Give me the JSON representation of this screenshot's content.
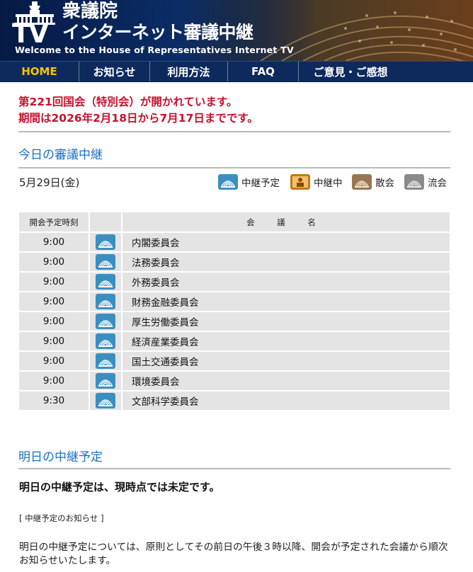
{
  "header": {
    "logo_tv": "TV",
    "site_name": "衆議院",
    "site_subtitle": "インターネット審議中継",
    "welcome": "Welcome to the House of Representatives Internet TV"
  },
  "nav": {
    "items": [
      {
        "label": "HOME"
      },
      {
        "label": "お知らせ"
      },
      {
        "label": "利用方法"
      },
      {
        "label": "FAQ"
      },
      {
        "label": "ご意見・ご感想"
      }
    ],
    "active_color": "#f5c400",
    "background": "#0e2a5c"
  },
  "notice": {
    "line1": "第221回国会（特別会）が開かれています。",
    "line2": "期間は2026年2月18日から7月17日までです。",
    "color": "#c8102e"
  },
  "today": {
    "heading": "今日の審議中継",
    "date": "5月29日(金)",
    "legend": [
      {
        "icon": "scheduled-broadcast-icon",
        "label": "中継予定"
      },
      {
        "icon": "live-broadcast-icon",
        "label": "中継中"
      },
      {
        "icon": "adjourned-icon",
        "label": "散会"
      },
      {
        "icon": "cancelled-icon",
        "label": "流会"
      }
    ],
    "table": {
      "headers": {
        "time": "開会予定時刻",
        "name": "会 議 名"
      },
      "rows": [
        {
          "time": "9:00",
          "name": "内閣委員会",
          "status": "scheduled-broadcast-icon"
        },
        {
          "time": "9:00",
          "name": "法務委員会",
          "status": "scheduled-broadcast-icon"
        },
        {
          "time": "9:00",
          "name": "外務委員会",
          "status": "scheduled-broadcast-icon"
        },
        {
          "time": "9:00",
          "name": "財務金融委員会",
          "status": "scheduled-broadcast-icon"
        },
        {
          "time": "9:00",
          "name": "厚生労働委員会",
          "status": "scheduled-broadcast-icon"
        },
        {
          "time": "9:00",
          "name": "経済産業委員会",
          "status": "scheduled-broadcast-icon"
        },
        {
          "time": "9:00",
          "name": "国土交通委員会",
          "status": "scheduled-broadcast-icon"
        },
        {
          "time": "9:00",
          "name": "環境委員会",
          "status": "scheduled-broadcast-icon"
        },
        {
          "time": "9:30",
          "name": "文部科学委員会",
          "status": "scheduled-broadcast-icon"
        }
      ]
    }
  },
  "tomorrow": {
    "heading": "明日の中継予定",
    "status_text": "明日の中継予定は、現時点では未定です。",
    "notice_label": "[ 中継予定のお知らせ ]",
    "body": "明日の中継予定については、原則としてその前日の午後３時以降、開会が予定された会議から順次お知らせいたします。"
  },
  "colors": {
    "heading_blue": "#1a6fc0",
    "icon_scheduled": "#3a8fc0",
    "icon_live": "#c07a18",
    "icon_adjourned": "#9a7650",
    "icon_cancelled": "#8a8a8a"
  }
}
